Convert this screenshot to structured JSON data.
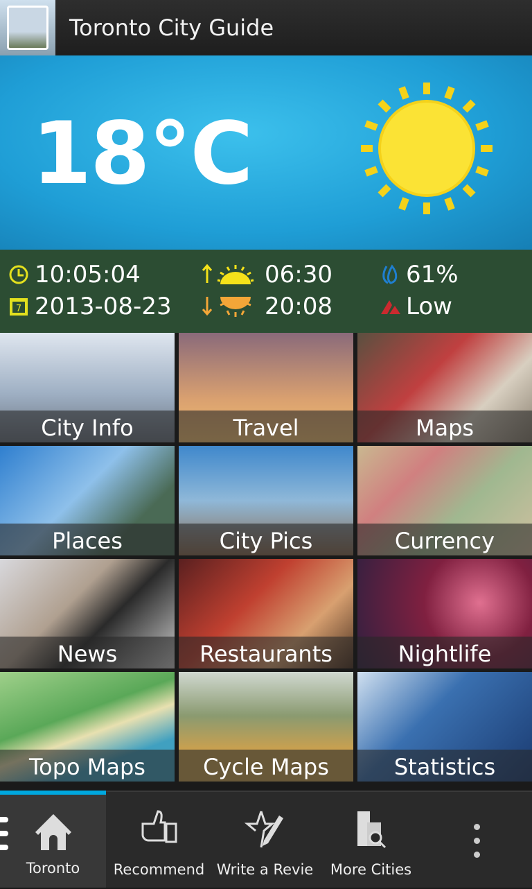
{
  "header": {
    "title": "Toronto City Guide",
    "logo_icon": "city-building-icon"
  },
  "weather": {
    "temperature": "18°C",
    "condition_icon": "sun-icon",
    "time": "10:05:04",
    "date": "2013-08-23",
    "sunrise": "06:30",
    "sunset": "20:08",
    "humidity": "61%",
    "uv": "Low",
    "colors": {
      "sky": "#1f9ed6",
      "panel": "#2c4d33",
      "yellow": "#f5e21a",
      "orange": "#f4a638",
      "humidity": "#1f7fd0",
      "uv": "#cc2a2f"
    }
  },
  "tiles": [
    {
      "label": "City Info"
    },
    {
      "label": "Travel"
    },
    {
      "label": "Maps"
    },
    {
      "label": "Places"
    },
    {
      "label": "City Pics"
    },
    {
      "label": "Currency"
    },
    {
      "label": "News"
    },
    {
      "label": "Restaurants"
    },
    {
      "label": "Nightlife"
    },
    {
      "label": "Topo Maps"
    },
    {
      "label": "Cycle Maps"
    },
    {
      "label": "Statistics"
    }
  ],
  "action_bar": {
    "items": [
      {
        "label": "Toronto",
        "icon": "home-icon"
      },
      {
        "label": "Recommend",
        "icon": "thumbs-up-icon"
      },
      {
        "label": "Write a Revie",
        "icon": "star-pen-icon"
      },
      {
        "label": "More Cities",
        "icon": "city-search-icon"
      }
    ],
    "overflow_icon": "more-vertical-icon",
    "accent": "#00a8df"
  }
}
